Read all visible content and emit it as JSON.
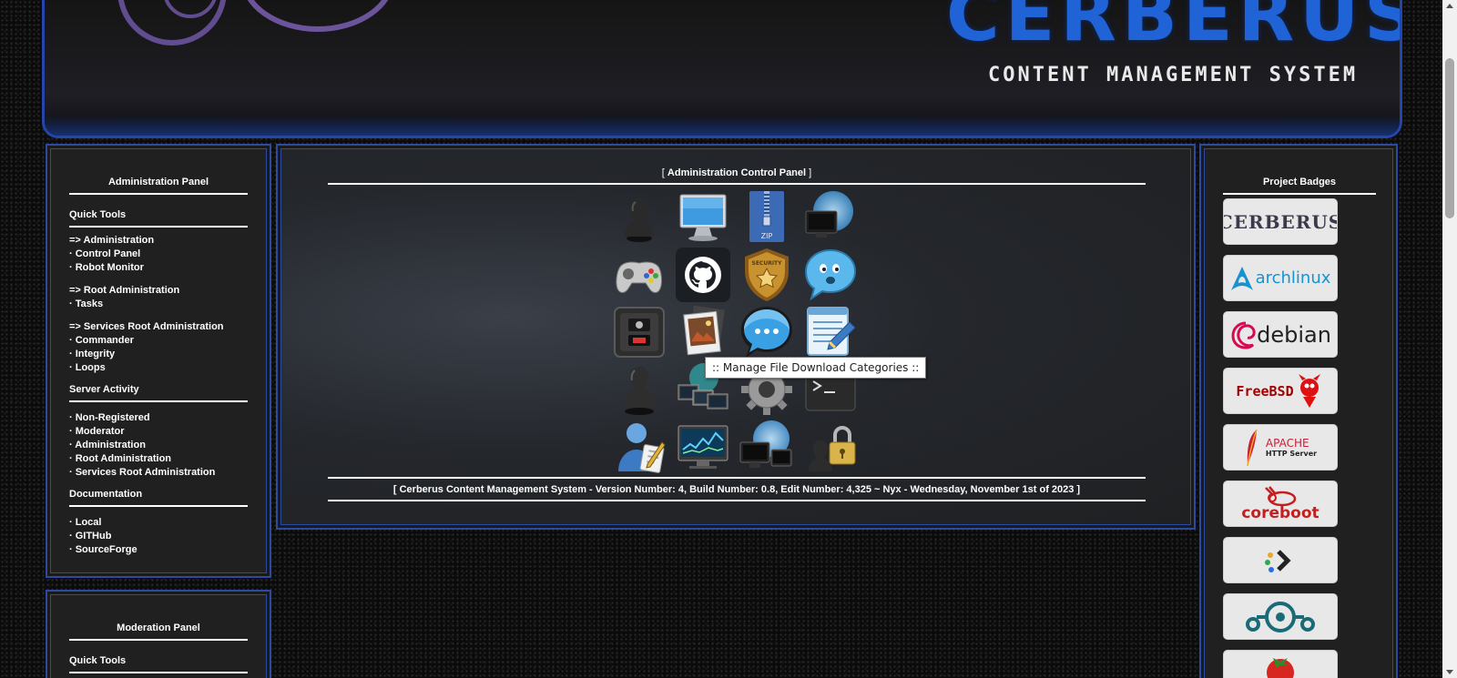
{
  "banner": {
    "title": "CERBERUS",
    "subtitle": "CONTENT MANAGEMENT SYSTEM"
  },
  "admin_panel": {
    "title": "Administration Panel",
    "quick_tools": "Quick Tools",
    "group1": [
      "=> Administration",
      "· Control Panel",
      "· Robot Monitor"
    ],
    "group2": [
      "=> Root Administration",
      "· Tasks"
    ],
    "group3": [
      "=> Services Root Administration",
      "· Commander",
      "· Integrity",
      "· Loops"
    ],
    "server_activity": "Server Activity",
    "activity": [
      "· Non-Registered",
      "· Moderator",
      "· Administration",
      "· Root Administration",
      "· Services Root Administration"
    ],
    "documentation": "Documentation",
    "docs": [
      "· Local",
      "· GITHub",
      "· SourceForge"
    ]
  },
  "moderation_panel": {
    "title": "Moderation Panel",
    "quick_tools": "Quick Tools"
  },
  "control_panel": {
    "title_prefix": "[ ",
    "title": "Administration Control Panel",
    "title_suffix": " ]",
    "footer": "[ Cerberus Content Management System - Version Number: 4, Build Number: 0.8, Edit Number: 4,325 ~ Nyx - Wednesday, November 1st of 2023 ]",
    "tooltip": ":: Manage File Download Categories ::",
    "icons": [
      "user-silhouette-icon",
      "monitor-icon",
      "zip-archive-icon",
      "network-globe-icon",
      "gamepad-icon",
      "github-icon",
      "security-badge-icon",
      "chat-bubble-icon",
      "power-switch-icon",
      "photo-gallery-icon",
      "message-bubble-icon",
      "notepad-icon",
      "user-silhouette-icon",
      "network-computers-icon",
      "gear-icon",
      "terminal-icon",
      "user-edit-icon",
      "monitor-chart-icon",
      "globe-computer-icon",
      "lock-user-icon"
    ]
  },
  "badges": {
    "title": "Project Badges",
    "items": [
      {
        "name": "cerberus",
        "label": "CERBERUS"
      },
      {
        "name": "archlinux",
        "label": "archlinux"
      },
      {
        "name": "debian",
        "label": "debian"
      },
      {
        "name": "freebsd",
        "label": "FreeBSD"
      },
      {
        "name": "apache",
        "label": "APACHE",
        "sublabel": "HTTP Server"
      },
      {
        "name": "coreboot",
        "label": "coreboot"
      },
      {
        "name": "terminal",
        "label": ""
      },
      {
        "name": "lineageos",
        "label": ""
      },
      {
        "name": "tomato",
        "label": ""
      }
    ]
  }
}
